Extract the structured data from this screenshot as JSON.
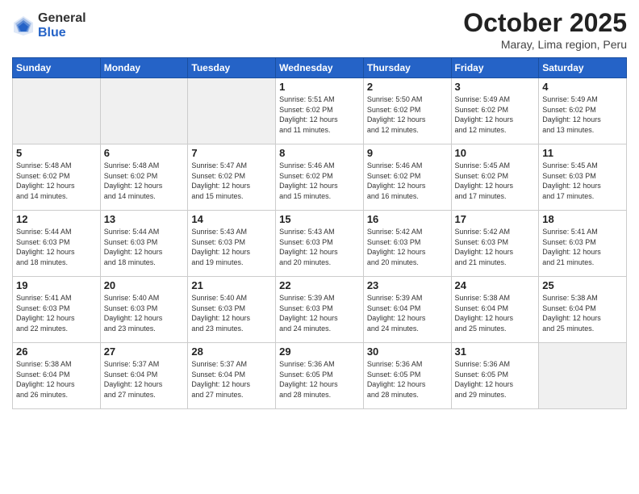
{
  "logo": {
    "general": "General",
    "blue": "Blue"
  },
  "title": "October 2025",
  "location": "Maray, Lima region, Peru",
  "days_header": [
    "Sunday",
    "Monday",
    "Tuesday",
    "Wednesday",
    "Thursday",
    "Friday",
    "Saturday"
  ],
  "weeks": [
    [
      {
        "num": "",
        "info": ""
      },
      {
        "num": "",
        "info": ""
      },
      {
        "num": "",
        "info": ""
      },
      {
        "num": "1",
        "info": "Sunrise: 5:51 AM\nSunset: 6:02 PM\nDaylight: 12 hours\nand 11 minutes."
      },
      {
        "num": "2",
        "info": "Sunrise: 5:50 AM\nSunset: 6:02 PM\nDaylight: 12 hours\nand 12 minutes."
      },
      {
        "num": "3",
        "info": "Sunrise: 5:49 AM\nSunset: 6:02 PM\nDaylight: 12 hours\nand 12 minutes."
      },
      {
        "num": "4",
        "info": "Sunrise: 5:49 AM\nSunset: 6:02 PM\nDaylight: 12 hours\nand 13 minutes."
      }
    ],
    [
      {
        "num": "5",
        "info": "Sunrise: 5:48 AM\nSunset: 6:02 PM\nDaylight: 12 hours\nand 14 minutes."
      },
      {
        "num": "6",
        "info": "Sunrise: 5:48 AM\nSunset: 6:02 PM\nDaylight: 12 hours\nand 14 minutes."
      },
      {
        "num": "7",
        "info": "Sunrise: 5:47 AM\nSunset: 6:02 PM\nDaylight: 12 hours\nand 15 minutes."
      },
      {
        "num": "8",
        "info": "Sunrise: 5:46 AM\nSunset: 6:02 PM\nDaylight: 12 hours\nand 15 minutes."
      },
      {
        "num": "9",
        "info": "Sunrise: 5:46 AM\nSunset: 6:02 PM\nDaylight: 12 hours\nand 16 minutes."
      },
      {
        "num": "10",
        "info": "Sunrise: 5:45 AM\nSunset: 6:02 PM\nDaylight: 12 hours\nand 17 minutes."
      },
      {
        "num": "11",
        "info": "Sunrise: 5:45 AM\nSunset: 6:03 PM\nDaylight: 12 hours\nand 17 minutes."
      }
    ],
    [
      {
        "num": "12",
        "info": "Sunrise: 5:44 AM\nSunset: 6:03 PM\nDaylight: 12 hours\nand 18 minutes."
      },
      {
        "num": "13",
        "info": "Sunrise: 5:44 AM\nSunset: 6:03 PM\nDaylight: 12 hours\nand 18 minutes."
      },
      {
        "num": "14",
        "info": "Sunrise: 5:43 AM\nSunset: 6:03 PM\nDaylight: 12 hours\nand 19 minutes."
      },
      {
        "num": "15",
        "info": "Sunrise: 5:43 AM\nSunset: 6:03 PM\nDaylight: 12 hours\nand 20 minutes."
      },
      {
        "num": "16",
        "info": "Sunrise: 5:42 AM\nSunset: 6:03 PM\nDaylight: 12 hours\nand 20 minutes."
      },
      {
        "num": "17",
        "info": "Sunrise: 5:42 AM\nSunset: 6:03 PM\nDaylight: 12 hours\nand 21 minutes."
      },
      {
        "num": "18",
        "info": "Sunrise: 5:41 AM\nSunset: 6:03 PM\nDaylight: 12 hours\nand 21 minutes."
      }
    ],
    [
      {
        "num": "19",
        "info": "Sunrise: 5:41 AM\nSunset: 6:03 PM\nDaylight: 12 hours\nand 22 minutes."
      },
      {
        "num": "20",
        "info": "Sunrise: 5:40 AM\nSunset: 6:03 PM\nDaylight: 12 hours\nand 23 minutes."
      },
      {
        "num": "21",
        "info": "Sunrise: 5:40 AM\nSunset: 6:03 PM\nDaylight: 12 hours\nand 23 minutes."
      },
      {
        "num": "22",
        "info": "Sunrise: 5:39 AM\nSunset: 6:03 PM\nDaylight: 12 hours\nand 24 minutes."
      },
      {
        "num": "23",
        "info": "Sunrise: 5:39 AM\nSunset: 6:04 PM\nDaylight: 12 hours\nand 24 minutes."
      },
      {
        "num": "24",
        "info": "Sunrise: 5:38 AM\nSunset: 6:04 PM\nDaylight: 12 hours\nand 25 minutes."
      },
      {
        "num": "25",
        "info": "Sunrise: 5:38 AM\nSunset: 6:04 PM\nDaylight: 12 hours\nand 25 minutes."
      }
    ],
    [
      {
        "num": "26",
        "info": "Sunrise: 5:38 AM\nSunset: 6:04 PM\nDaylight: 12 hours\nand 26 minutes."
      },
      {
        "num": "27",
        "info": "Sunrise: 5:37 AM\nSunset: 6:04 PM\nDaylight: 12 hours\nand 27 minutes."
      },
      {
        "num": "28",
        "info": "Sunrise: 5:37 AM\nSunset: 6:04 PM\nDaylight: 12 hours\nand 27 minutes."
      },
      {
        "num": "29",
        "info": "Sunrise: 5:36 AM\nSunset: 6:05 PM\nDaylight: 12 hours\nand 28 minutes."
      },
      {
        "num": "30",
        "info": "Sunrise: 5:36 AM\nSunset: 6:05 PM\nDaylight: 12 hours\nand 28 minutes."
      },
      {
        "num": "31",
        "info": "Sunrise: 5:36 AM\nSunset: 6:05 PM\nDaylight: 12 hours\nand 29 minutes."
      },
      {
        "num": "",
        "info": ""
      }
    ]
  ]
}
